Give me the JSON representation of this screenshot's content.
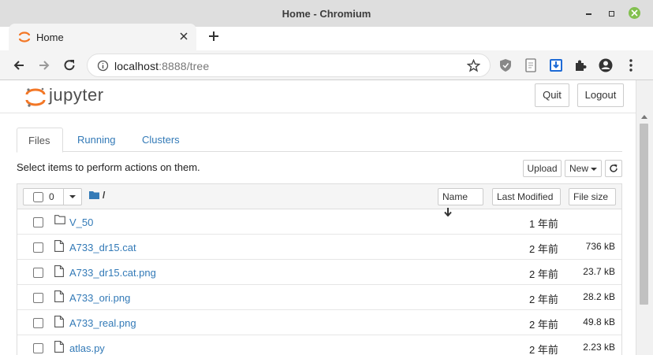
{
  "window": {
    "title": "Home - Chromium"
  },
  "browser": {
    "tab": {
      "title": "Home"
    },
    "url_host": "localhost",
    "url_rest": ":8888/tree"
  },
  "header": {
    "logo_text": "jupyter",
    "quit_label": "Quit",
    "logout_label": "Logout"
  },
  "tabs": [
    {
      "label": "Files",
      "active": true
    },
    {
      "label": "Running",
      "active": false
    },
    {
      "label": "Clusters",
      "active": false
    }
  ],
  "toolbar": {
    "hint": "Select items to perform actions on them.",
    "upload_label": "Upload",
    "new_label": "New"
  },
  "list": {
    "selected_count": "0",
    "path": "/",
    "col_name": "Name",
    "col_modified": "Last Modified",
    "col_size": "File size",
    "rows": [
      {
        "type": "folder",
        "name": "V_50",
        "modified": "1 年前",
        "size": ""
      },
      {
        "type": "file",
        "name": "A733_dr15.cat",
        "modified": "2 年前",
        "size": "736 kB"
      },
      {
        "type": "file",
        "name": "A733_dr15.cat.png",
        "modified": "2 年前",
        "size": "23.7 kB"
      },
      {
        "type": "file",
        "name": "A733_ori.png",
        "modified": "2 年前",
        "size": "28.2 kB"
      },
      {
        "type": "file",
        "name": "A733_real.png",
        "modified": "2 年前",
        "size": "49.8 kB"
      },
      {
        "type": "file",
        "name": "atlas.py",
        "modified": "2 年前",
        "size": "2.23 kB"
      }
    ]
  }
}
